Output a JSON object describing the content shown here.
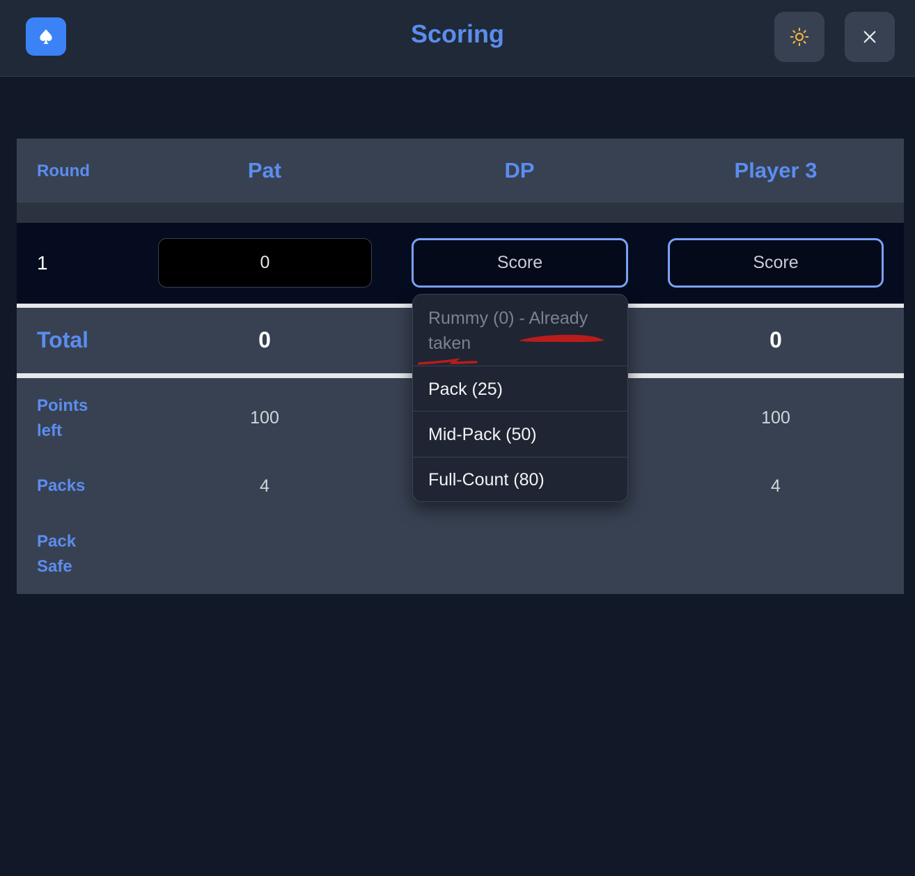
{
  "header": {
    "title": "Scoring",
    "app_icon": "spade-icon",
    "theme_icon": "sun-icon",
    "close_icon": "close-icon"
  },
  "table": {
    "round_label": "Round",
    "players": [
      "Pat",
      "DP",
      "Player 3"
    ],
    "rounds": [
      {
        "number": "1",
        "pat_value": "0",
        "dp_placeholder": "Score",
        "p3_placeholder": "Score"
      }
    ],
    "total_label": "Total",
    "totals": {
      "pat": "0",
      "player3": "0"
    },
    "points_left_label": "Points left",
    "points_left": {
      "pat": "100",
      "player3": "100"
    },
    "packs_label": "Packs",
    "packs": {
      "pat": "4",
      "player3": "4"
    },
    "pack_safe_label": "Pack Safe"
  },
  "dropdown": {
    "options": [
      {
        "label": "Rummy (0) - Already taken",
        "disabled": true
      },
      {
        "label": "Pack (25)",
        "disabled": false
      },
      {
        "label": "Mid-Pack (50)",
        "disabled": false
      },
      {
        "label": "Full-Count (80)",
        "disabled": false
      }
    ]
  },
  "colors": {
    "accent": "#5b8def",
    "app_icon_bg": "#3b82f6",
    "background": "#111827",
    "annotation_red": "#b91c1c",
    "sun_icon": "#f5b841"
  }
}
